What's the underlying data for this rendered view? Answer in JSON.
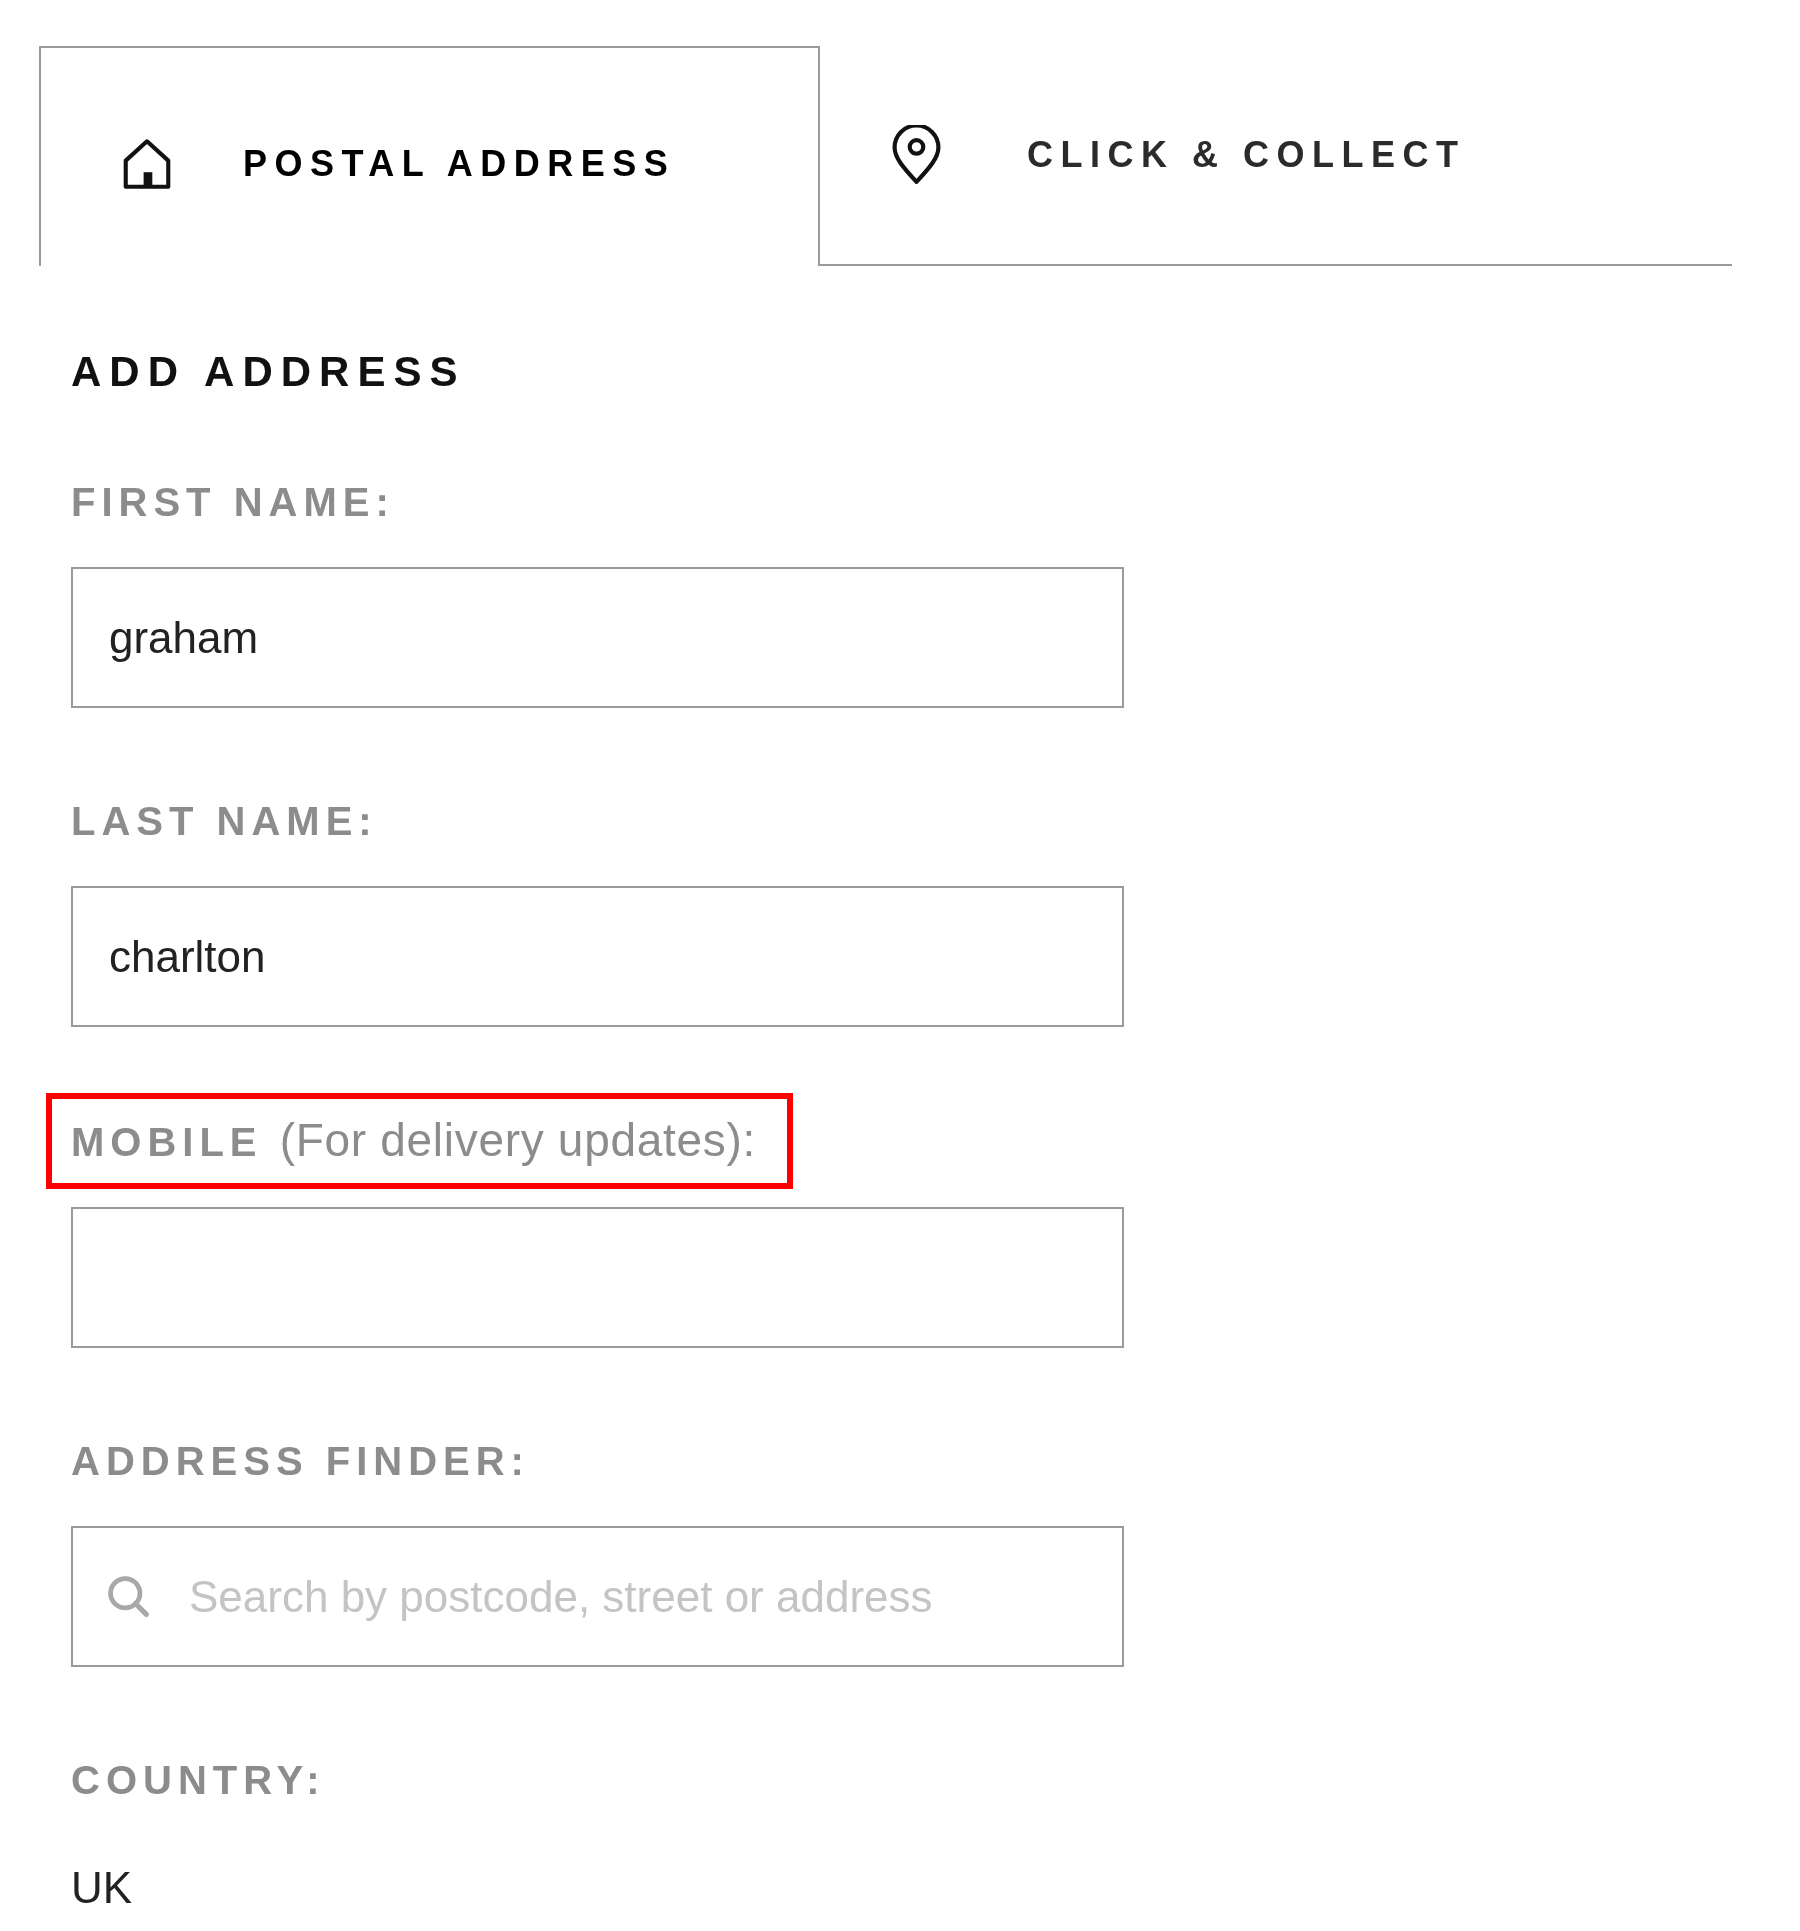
{
  "tabs": [
    {
      "label": "POSTAL ADDRESS",
      "selected": true
    },
    {
      "label": "CLICK & COLLECT",
      "selected": false
    }
  ],
  "form": {
    "title": "ADD ADDRESS",
    "fields": [
      {
        "kind": "text",
        "label": "FIRST NAME:",
        "value": "graham",
        "highlighted": false
      },
      {
        "kind": "text",
        "label": "LAST NAME:",
        "value": "charlton",
        "highlighted": false
      },
      {
        "kind": "text",
        "label": "MOBILE",
        "note": "(For delivery updates):",
        "highlighted": true
      },
      {
        "kind": "search",
        "label": "ADDRESS FINDER:",
        "placeholder": "Search by postcode, street or address",
        "highlighted": false
      },
      {
        "kind": "static",
        "label": "COUNTRY:",
        "value": "UK",
        "highlighted": false
      }
    ]
  }
}
